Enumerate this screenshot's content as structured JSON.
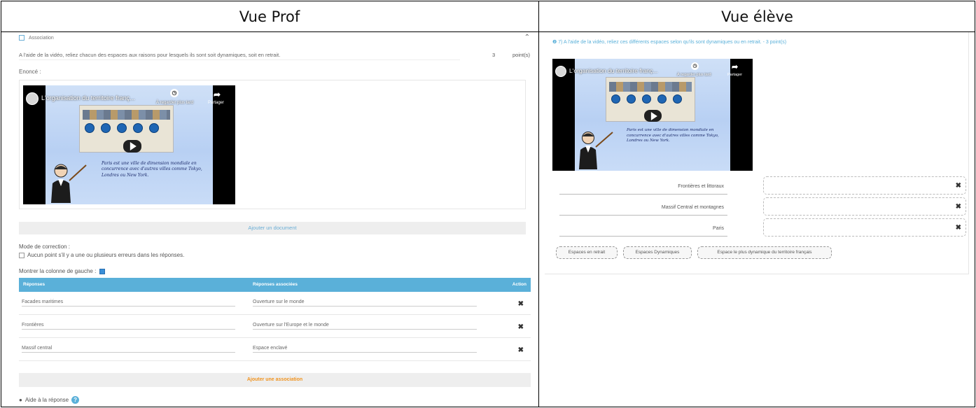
{
  "headers": {
    "prof": "Vue Prof",
    "eleve": "Vue élève"
  },
  "prof": {
    "section_title": "Association",
    "question_text": "A l'aide de la vidéo, reliez chacun des espaces aux raisons pour lesquels ils sont soit dynamiques, soit en retrait.",
    "points_value": "3",
    "points_label": "point(s)",
    "enonce_label": "Enoncé :",
    "video": {
      "title": "L'organisation du territoire franç...",
      "later_label": "À regarder plus tard",
      "share_label": "Partager",
      "caption_lines": [
        "Paris est une ville de dimension mondiale en",
        "concurrence avec d'autres villes comme Tokyo,",
        "Londres ou New York."
      ]
    },
    "add_document_label": "Ajouter un document",
    "mode_label": "Mode de correction :",
    "mode_option": "Aucun point s'il y a une ou plusieurs erreurs dans les réponses.",
    "show_left_col_label": "Montrer la colonne de gauche :",
    "show_left_col_checked": true,
    "table": {
      "headers": {
        "responses": "Réponses",
        "associated": "Réponses associées",
        "action": "Action"
      },
      "rows": [
        {
          "left": "Facades maritimes",
          "right": "Ouverture sur le monde"
        },
        {
          "left": "Frontières",
          "right": "Ouverture sur l'Europe et le monde"
        },
        {
          "left": "Massif central",
          "right": "Espace enclavé"
        }
      ]
    },
    "add_association_label": "Ajouter une association",
    "help_label": "Aide à la réponse",
    "help_icon": "?"
  },
  "eleve": {
    "question": "❷ 7) A l'aide de la vidéo, reliez ces différents espaces selon qu'ils sont dynamiques ou en retrait. - 3 point(s)",
    "video": {
      "title": "L'organisation du territoire franç...",
      "later_label": "À regarder plus tard",
      "share_label": "Partager",
      "caption_lines": [
        "Paris est une ville de dimension mondiale en",
        "concurrence avec d'autres villes comme Tokyo,",
        "Londres ou New York."
      ]
    },
    "items": [
      {
        "label": "Frontières et littoraux"
      },
      {
        "label": "Massif Central et montagnes"
      },
      {
        "label": "Paris"
      }
    ],
    "chips": [
      "Espaces en retrait",
      "Espaces Dynamiques",
      "Espace le plus dynamique du territoire français"
    ]
  },
  "colors": {
    "accent": "#5ab0d9",
    "orange": "#f0931f",
    "table_header": "#5ab0d9"
  }
}
